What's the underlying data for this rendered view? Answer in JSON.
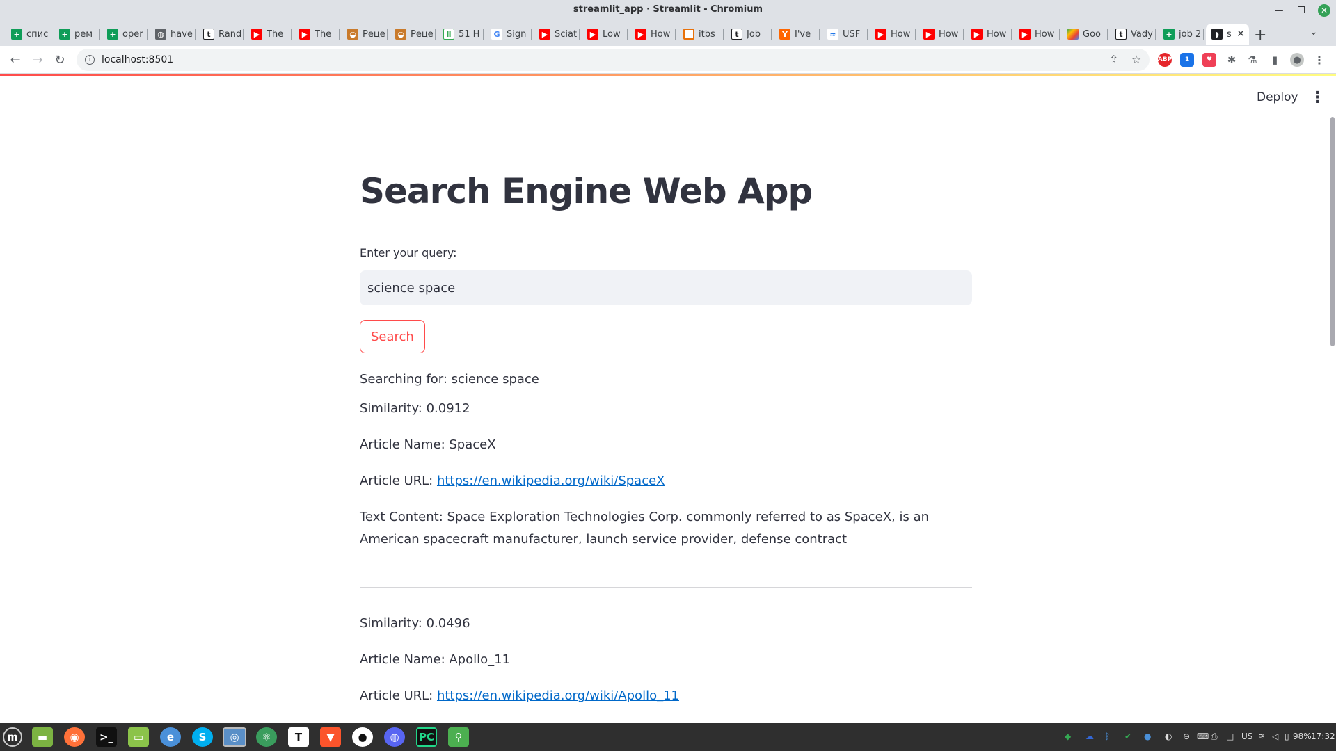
{
  "window": {
    "title": "streamlit_app · Streamlit - Chromium"
  },
  "tabs": [
    {
      "label": "спис",
      "icon": "sheets"
    },
    {
      "label": "рем",
      "icon": "sheets"
    },
    {
      "label": "oper",
      "icon": "sheets"
    },
    {
      "label": "have",
      "icon": "globe"
    },
    {
      "label": "Rand",
      "icon": "t-box"
    },
    {
      "label": "The",
      "icon": "youtube"
    },
    {
      "label": "The",
      "icon": "youtube"
    },
    {
      "label": "Реце",
      "icon": "soup"
    },
    {
      "label": "Реце",
      "icon": "soup"
    },
    {
      "label": "51 H",
      "icon": "tally"
    },
    {
      "label": "Sign",
      "icon": "google"
    },
    {
      "label": "Sciat",
      "icon": "youtube"
    },
    {
      "label": "Low",
      "icon": "youtube"
    },
    {
      "label": "How",
      "icon": "youtube"
    },
    {
      "label": "itbs",
      "icon": "itbs"
    },
    {
      "label": "Job",
      "icon": "t-box"
    },
    {
      "label": "I've",
      "icon": "ycombinator"
    },
    {
      "label": "USF",
      "icon": "usf"
    },
    {
      "label": "How",
      "icon": "youtube"
    },
    {
      "label": "How",
      "icon": "youtube"
    },
    {
      "label": "How",
      "icon": "youtube"
    },
    {
      "label": "How",
      "icon": "youtube"
    },
    {
      "label": "Goo",
      "icon": "google-play"
    },
    {
      "label": "Vady",
      "icon": "t-box"
    },
    {
      "label": "job 2",
      "icon": "sheets"
    },
    {
      "label": "s",
      "icon": "streamlit",
      "active": true
    }
  ],
  "toolbar": {
    "url": "localhost:8501"
  },
  "app": {
    "deploy_label": "Deploy",
    "title": "Search Engine Web App",
    "query_label": "Enter your query:",
    "query_value": "science space",
    "search_button": "Search",
    "searching_for": "Searching for: science space",
    "results": [
      {
        "similarity": "Similarity: 0.0912",
        "name": "Article Name: SpaceX",
        "url_prefix": "Article URL: ",
        "url": "https://en.wikipedia.org/wiki/SpaceX",
        "text": "Text Content: Space Exploration Technologies Corp. commonly referred to as SpaceX, is an American spacecraft manufacturer, launch service provider, defense contract"
      },
      {
        "similarity": "Similarity: 0.0496",
        "name": "Article Name: Apollo_11",
        "url_prefix": "Article URL: ",
        "url": "https://en.wikipedia.org/wiki/Apollo_11"
      }
    ]
  },
  "taskbar": {
    "tray_lang": "US",
    "battery": "98%",
    "clock": "17:32"
  }
}
